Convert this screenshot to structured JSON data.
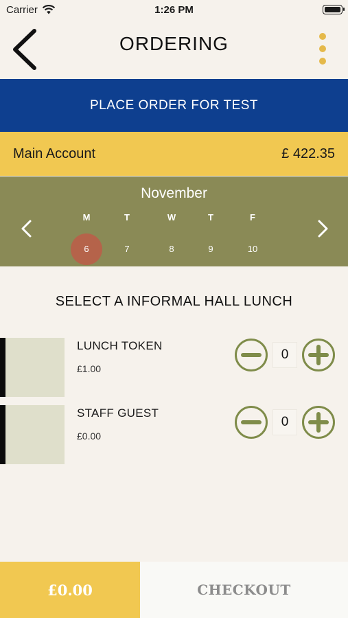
{
  "status_bar": {
    "carrier": "Carrier",
    "time": "1:26 PM"
  },
  "nav": {
    "title": "ORDERING"
  },
  "banner": {
    "label": "PLACE ORDER FOR TEST"
  },
  "account": {
    "name": "Main Account",
    "balance": "£ 422.35"
  },
  "calendar": {
    "month": "November",
    "days": [
      {
        "name": "M",
        "date": "6",
        "selected": true
      },
      {
        "name": "T",
        "date": "7",
        "selected": false
      },
      {
        "name": "W",
        "date": "8",
        "selected": false
      },
      {
        "name": "T",
        "date": "9",
        "selected": false
      },
      {
        "name": "F",
        "date": "10",
        "selected": false
      }
    ]
  },
  "section": {
    "title": "SELECT A INFORMAL HALL LUNCH"
  },
  "items": [
    {
      "name": "LUNCH TOKEN",
      "price": "£1.00",
      "quantity": "0"
    },
    {
      "name": "STAFF GUEST",
      "price": "£0.00",
      "quantity": "0"
    }
  ],
  "footer": {
    "total": "£0.00",
    "checkout_label": "CHECKOUT"
  },
  "colors": {
    "accent_yellow": "#f1c851",
    "banner_blue": "#0e3f8f",
    "calendar_olive": "#8a8a56",
    "selected_date": "#b5634a",
    "stepper_olive": "#7f8c4a"
  }
}
